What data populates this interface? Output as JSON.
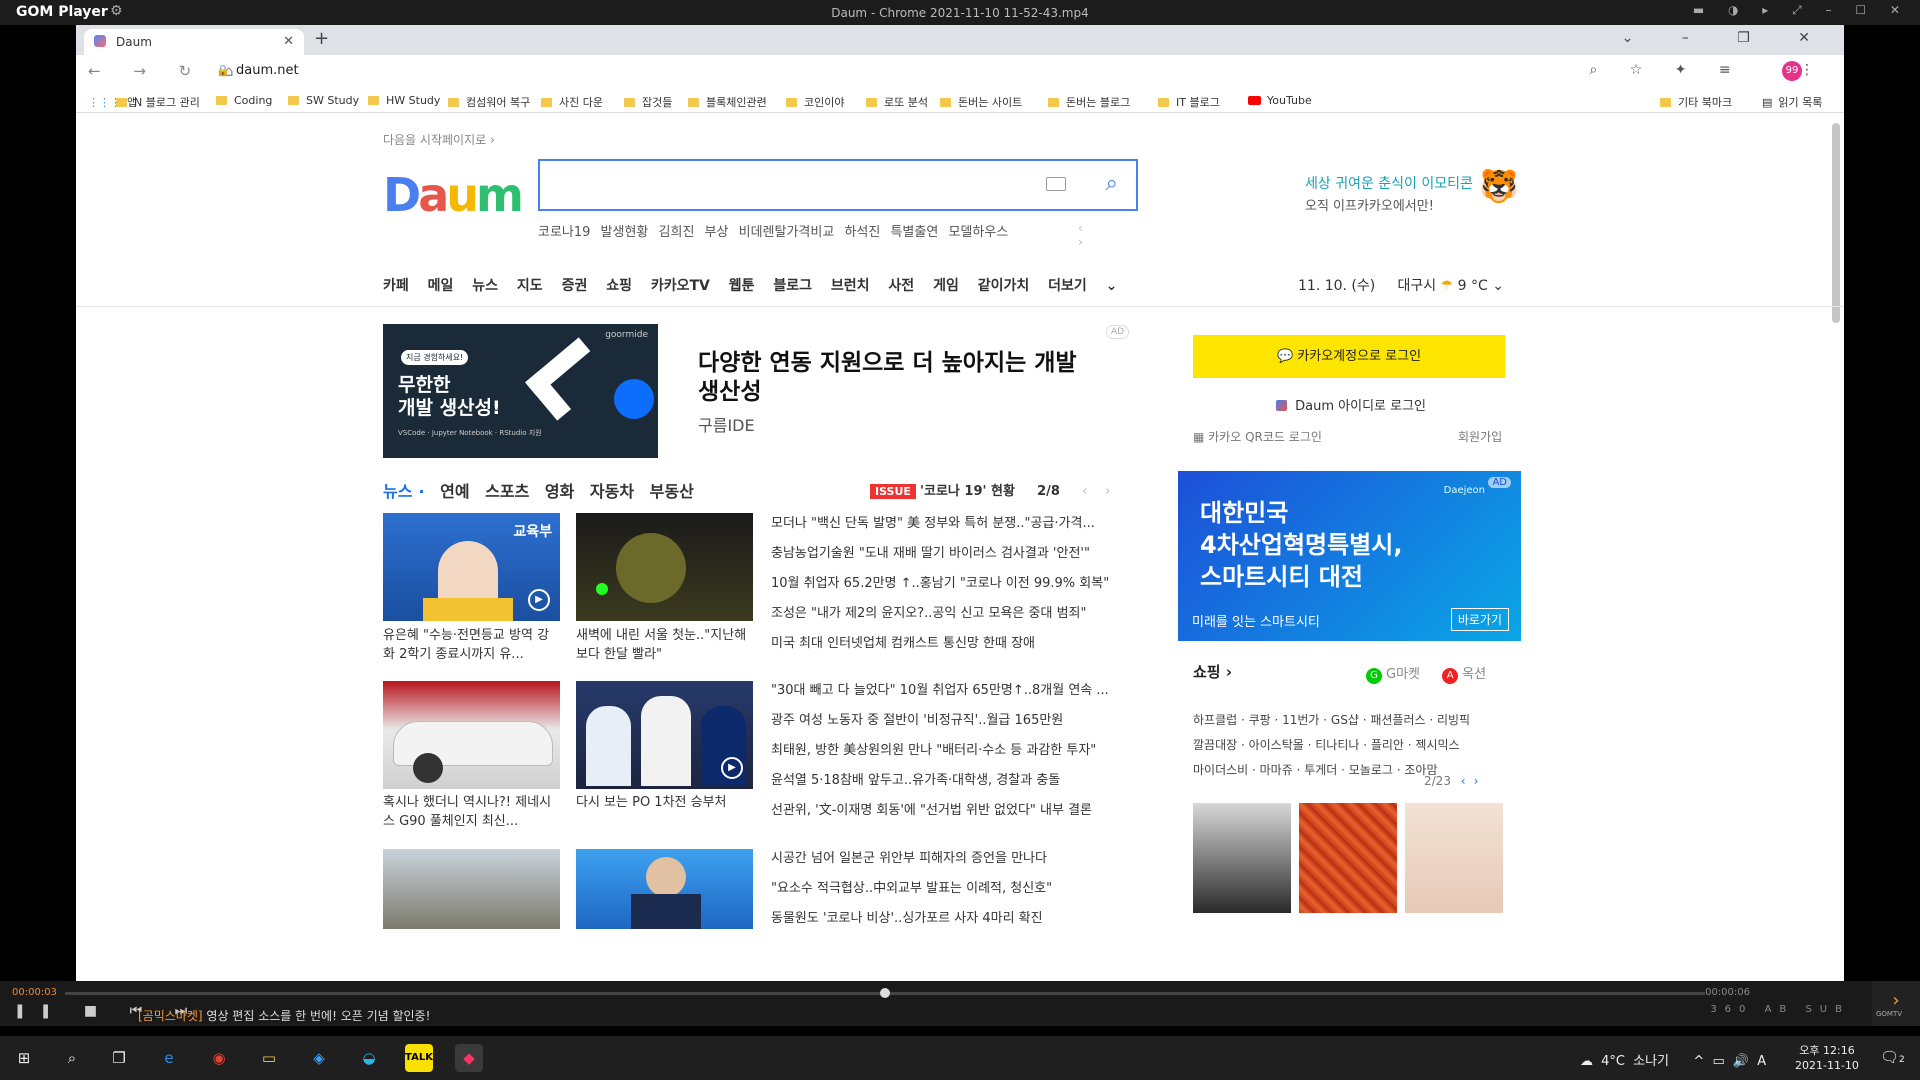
{
  "gom": {
    "app": "GOM Player",
    "title": "Daum - Chrome 2021-11-10 11-52-43.mp4",
    "time_elapsed": "00:00:03",
    "time_total": "00:00:06",
    "marquee_prefix": "[곰믹스마켓]",
    "marquee": "영상 편집 소스를 한 번에! 오픈 기념 할인중!",
    "right_icons": "360 AB SUB",
    "gomtv": "GOMTV"
  },
  "chrome": {
    "tab_title": "Daum",
    "url": "daum.net",
    "profile": "99",
    "bookmarks": [
      {
        "label": "앱"
      },
      {
        "label": "N 블로그 관리"
      },
      {
        "label": "Coding"
      },
      {
        "label": "SW Study"
      },
      {
        "label": "HW Study"
      },
      {
        "label": "컴섬워어 복구"
      },
      {
        "label": "사진 다운"
      },
      {
        "label": "잡것들"
      },
      {
        "label": "블록체인관련"
      },
      {
        "label": "코인이야"
      },
      {
        "label": "로또 분석"
      },
      {
        "label": "돈버는 사이트"
      },
      {
        "label": "돈버는 블로그"
      },
      {
        "label": "IT 블로그"
      },
      {
        "label": "YouTube"
      },
      {
        "label": "기타 북마크"
      },
      {
        "label": "읽기 목록"
      }
    ]
  },
  "daum": {
    "start_page": "다음을 시작페이지로 ›",
    "logo": "Daum",
    "hot_keywords": [
      "코로나19 발생현황",
      "김희진 부상",
      "비데렌탈가격비교",
      "하석진 특별출연",
      "모델하우스"
    ],
    "top_ad_line1": "세상 귀여운 춘식이 이모티콘",
    "top_ad_line2": "오직 이프카카오에서만!",
    "menu": [
      "카페",
      "메일",
      "뉴스",
      "지도",
      "증권",
      "쇼핑",
      "카카오TV",
      "웹툰",
      "블로그",
      "브런치",
      "사전",
      "게임",
      "같이가치",
      "더보기 ⌄"
    ],
    "date": "11. 10. (수)",
    "city": "대구시",
    "temp": "9 °C",
    "banner": {
      "tag": "지금 경험하세요!",
      "line1": "무한한",
      "line2": "개발 생산성!",
      "small": "VSCode · Jupyter Notebook · RStudio 지원",
      "brand": "goormide",
      "headline": "다양한 연동 지원으로 더 높아지는 개발 생산성",
      "sub": "구름IDE",
      "ad": "AD"
    },
    "news_tabs": [
      "뉴스",
      "연예",
      "스포츠",
      "영화",
      "자동차",
      "부동산"
    ],
    "issue_badge": "ISSUE",
    "issue_text": "'코로나 19' 현황",
    "issue_page": "2/8",
    "thumbs": [
      {
        "caption": "유은혜 \"수능·전면등교 방역 강화 2학기 종료시까지 유...",
        "label": "교육부"
      },
      {
        "caption": "새벽에 내린 서울 첫눈..\"지난해보다 한달 빨라\""
      },
      {
        "caption": "혹시나 했더니 역시나?! 제네시스 G90 풀체인지 최신..."
      },
      {
        "caption": "다시 보는 PO 1차전 승부처"
      }
    ],
    "news": [
      "모더나 \"백신 단독 발명\" 美 정부와 특허 분쟁..\"공급·가격...",
      "충남농업기술원 \"도내 재배 딸기 바이러스 검사결과 '안전'\"",
      "10월 취업자 65.2만명 ↑..홍남기 \"코로나 이전 99.9% 회복\"",
      "조성은 \"내가 제2의 윤지오?..공익 신고 모욕은 중대 범죄\"",
      "미국 최대 인터넷업체 컴캐스트 통신망 한때 장애",
      "\"30대 빼고 다 늘었다\" 10월 취업자 65만명↑..8개월 연속 ...",
      "광주 여성 노동자 중 절반이 '비정규직'..월급 165만원",
      "최태원, 방한 美상원의원 만나 \"배터리·수소 등 과감한 투자\"",
      "윤석열 5·18참배 앞두고..유가족·대학생, 경찰과 충돌",
      "선관위, '文-이재명 회동'에 \"선거법 위반 없었다\" 내부 결론",
      "시공간 넘어 일본군 위안부 피해자의 증언을 만나다",
      "\"요소수 적극협상..中외교부 발표는 이례적, 청신호\"",
      "동물원도 '코로나 비상'..싱가포르 사자 4마리 확진"
    ],
    "kakao_login": "카카오계정으로 로그인",
    "daum_login": "Daum 아이디로 로그인",
    "qr_login": "카카오 QR코드 로그인",
    "join": "회원가입",
    "smartcity": {
      "line1": "대한민국",
      "line2": "4차산업혁명특별시,",
      "line3": "스마트시티 대전",
      "sub": "미래를 잇는 스마트시티",
      "button": "바로가기",
      "ad": "AD",
      "brand": "Daejeon"
    },
    "shopping_title": "쇼핑 ›",
    "gmarket": "G마켓",
    "auction": "옥션",
    "shop_lines": [
      "하프클럽 · 쿠팡 · 11번가 · GS샵 · 패션플러스 · 리빙픽",
      "깔끔대장 · 아이스탁몰 · 티나티나 · 플리안 · 젝시믹스",
      "마이더스비 · 마마쥬 · 투게더 · 모놀로그 · 조아맘"
    ],
    "shop_page": "2/23"
  },
  "taskbar": {
    "weather": "4°C 소나기",
    "ime": "A",
    "time": "오후 12:16",
    "date": "2021-11-10",
    "notifications": "2"
  },
  "colors": {
    "kakao_yellow": "#fee500",
    "daum_blue": "#4a7ff0",
    "issue_red": "#e33333",
    "gom_orange": "#ff9933"
  }
}
